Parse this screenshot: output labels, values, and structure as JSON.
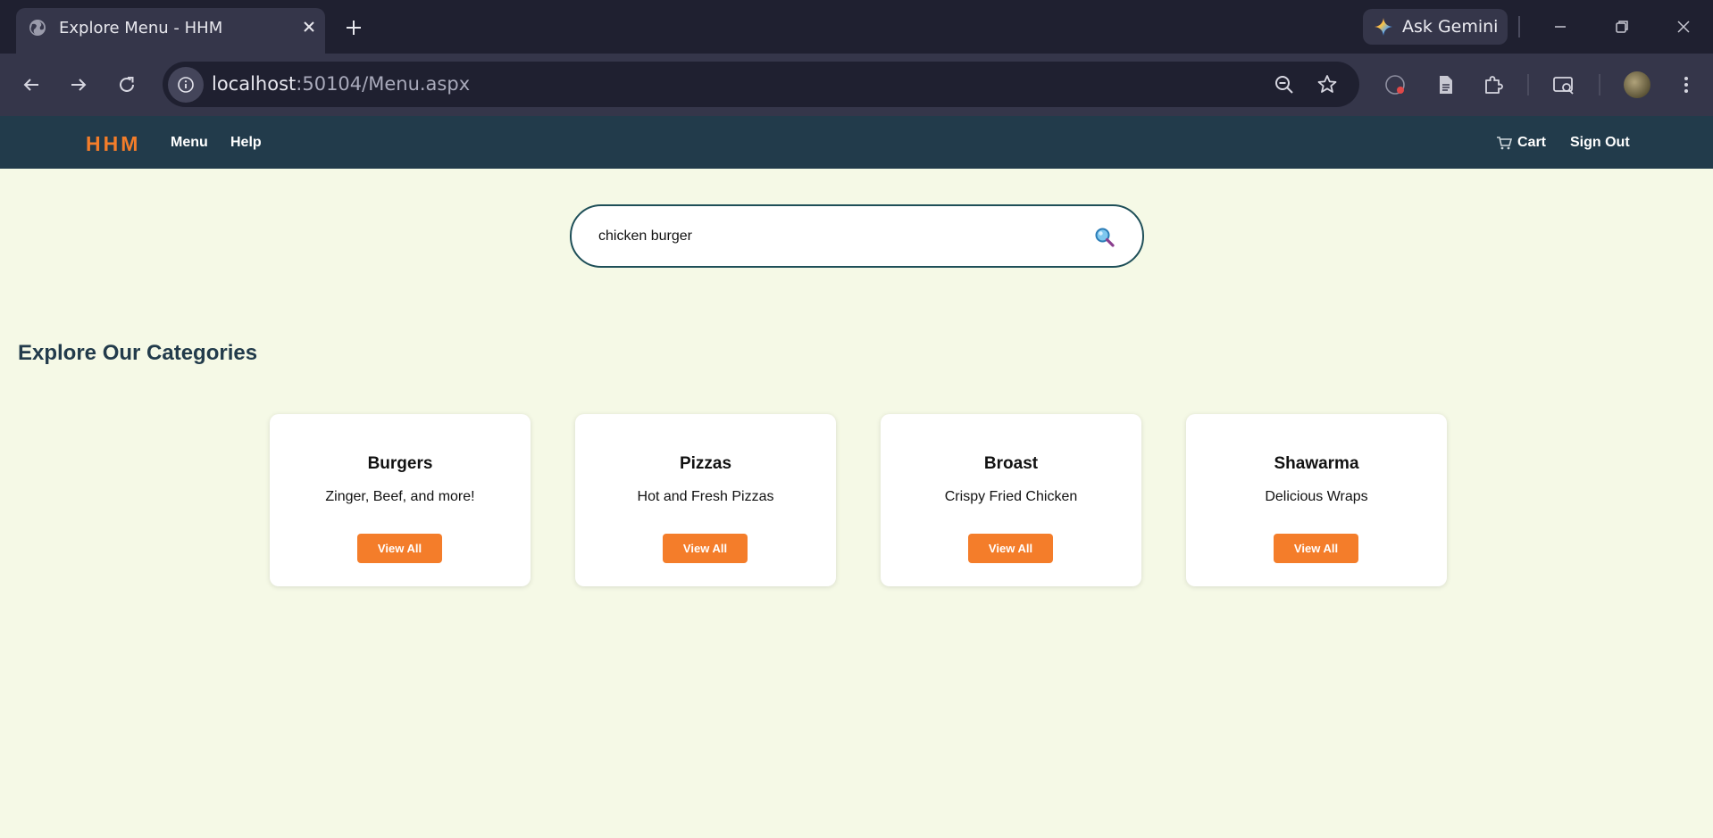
{
  "browser": {
    "tab_title": "Explore Menu - HHM",
    "url_host": "localhost",
    "url_path": ":50104/Menu.aspx",
    "gemini_label": "Ask Gemini"
  },
  "site": {
    "logo": "HHM",
    "nav": {
      "menu": "Menu",
      "help": "Help",
      "cart": "Cart",
      "sign_out": "Sign Out"
    },
    "search": {
      "value": "chicken burger"
    },
    "section_title": "Explore Our Categories",
    "categories": [
      {
        "title": "Burgers",
        "description": "Zinger, Beef, and more!",
        "button": "View All"
      },
      {
        "title": "Pizzas",
        "description": "Hot and Fresh Pizzas",
        "button": "View All"
      },
      {
        "title": "Broast",
        "description": "Crispy Fried Chicken",
        "button": "View All"
      },
      {
        "title": "Shawarma",
        "description": "Delicious Wraps",
        "button": "View All"
      }
    ]
  },
  "colors": {
    "accent": "#f47d2a",
    "navbar": "#223b4b",
    "page_background": "#f5f9e6",
    "search_border": "#1e4f58"
  },
  "icons": [
    "globe-icon",
    "close-icon",
    "plus-icon",
    "gemini-icon",
    "minimize-icon",
    "restore-icon",
    "back-icon",
    "forward-icon",
    "reload-icon",
    "site-info-icon",
    "zoom-out-icon",
    "bookmark-star-icon",
    "extension-badge-icon",
    "document-icon",
    "puzzle-icon",
    "tab-search-icon",
    "avatar",
    "more-vertical-icon",
    "cart-icon",
    "magnifier-icon"
  ]
}
